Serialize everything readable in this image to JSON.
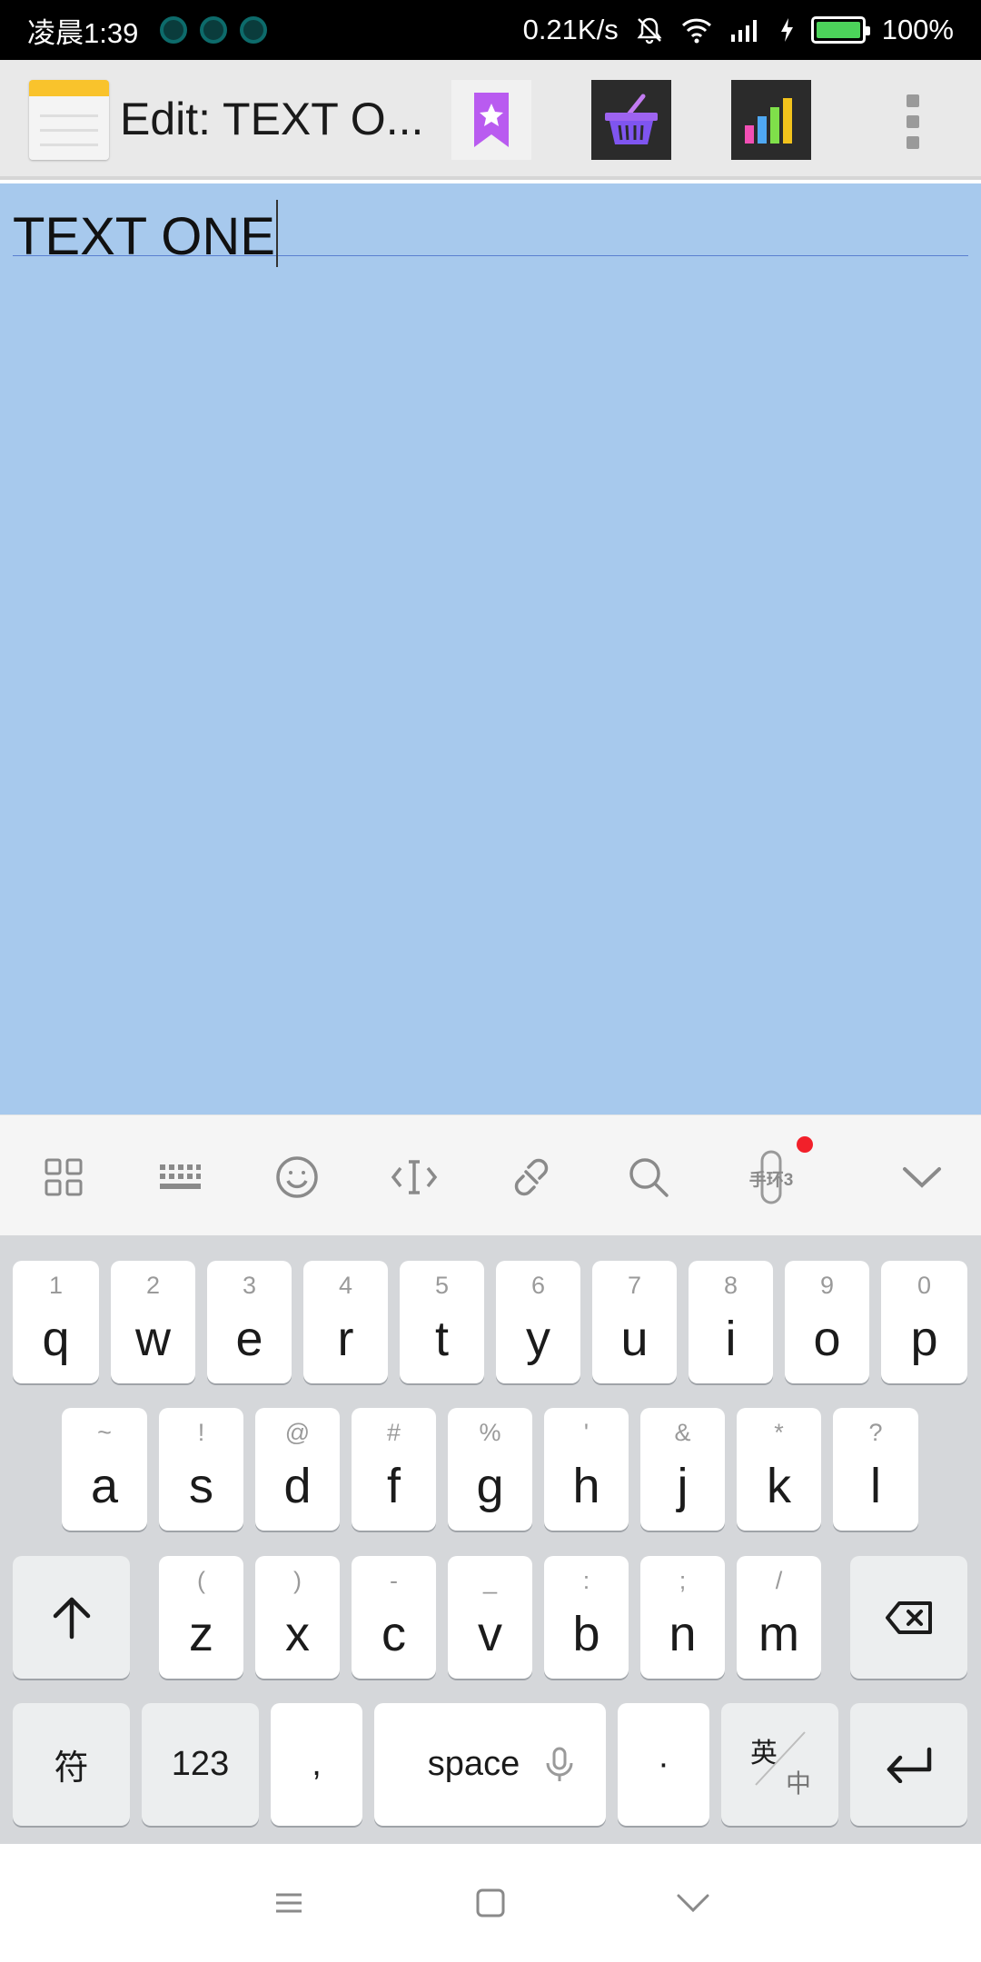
{
  "status_bar": {
    "time": "凌晨1:39",
    "net_speed": "0.21K/s",
    "battery": "100%",
    "battery_level": 1.0,
    "notification_icons": [
      "notification-icon",
      "notification-icon",
      "notification-icon"
    ]
  },
  "toolbar": {
    "title": "Edit: TEXT O...",
    "actions": [
      "bookmark-star-icon",
      "basket-icon",
      "bar-chart-icon",
      "overflow-menu-icon"
    ]
  },
  "editor": {
    "text": "TEXT ONE",
    "background": "#a7c9ed"
  },
  "keyboard_toolbar": {
    "items": [
      "apps-grid-icon",
      "keyboard-icon",
      "emoji-icon",
      "text-cursor-icon",
      "link-icon",
      "search-icon",
      "bracelet-icon",
      "collapse-keyboard-icon"
    ],
    "bracelet_label": "手环3"
  },
  "keyboard": {
    "row1": [
      {
        "key": "q",
        "hint": "1"
      },
      {
        "key": "w",
        "hint": "2"
      },
      {
        "key": "e",
        "hint": "3"
      },
      {
        "key": "r",
        "hint": "4"
      },
      {
        "key": "t",
        "hint": "5"
      },
      {
        "key": "y",
        "hint": "6"
      },
      {
        "key": "u",
        "hint": "7"
      },
      {
        "key": "i",
        "hint": "8"
      },
      {
        "key": "o",
        "hint": "9"
      },
      {
        "key": "p",
        "hint": "0"
      }
    ],
    "row2": [
      {
        "key": "a",
        "hint": "~"
      },
      {
        "key": "s",
        "hint": "!"
      },
      {
        "key": "d",
        "hint": "@"
      },
      {
        "key": "f",
        "hint": "#"
      },
      {
        "key": "g",
        "hint": "%"
      },
      {
        "key": "h",
        "hint": "'"
      },
      {
        "key": "j",
        "hint": "&"
      },
      {
        "key": "k",
        "hint": "*"
      },
      {
        "key": "l",
        "hint": "?"
      }
    ],
    "row3": [
      {
        "key": "z",
        "hint": "("
      },
      {
        "key": "x",
        "hint": ")"
      },
      {
        "key": "c",
        "hint": "-"
      },
      {
        "key": "v",
        "hint": "_"
      },
      {
        "key": "b",
        "hint": ":"
      },
      {
        "key": "n",
        "hint": ";"
      },
      {
        "key": "m",
        "hint": "/"
      }
    ],
    "symbols_label": "符",
    "numbers_label": "123",
    "comma_label": ",",
    "space_label": "space",
    "period_label": "·",
    "lang_top": "英",
    "lang_bottom": "中"
  },
  "nav_bar": {
    "items": [
      "menu-icon",
      "home-icon",
      "back-icon"
    ]
  }
}
